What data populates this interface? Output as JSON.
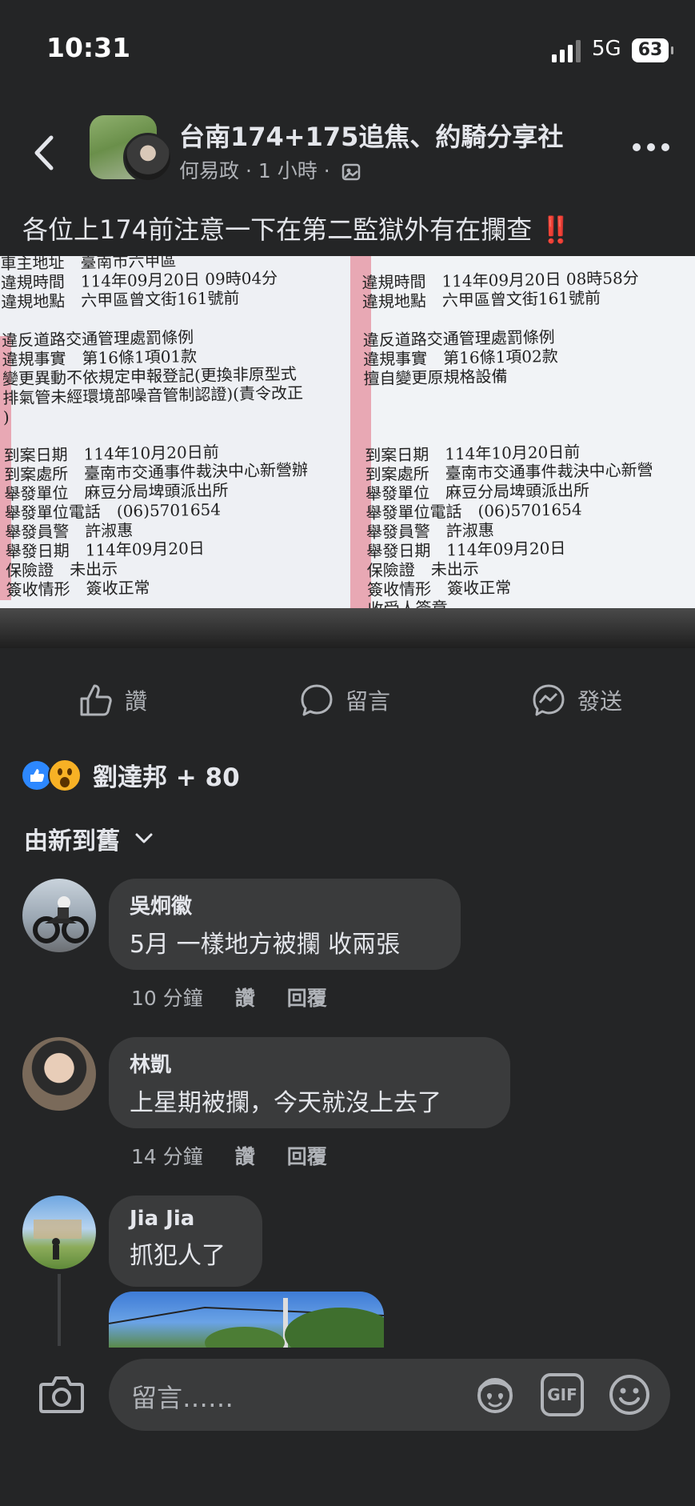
{
  "status_bar": {
    "time": "10:31",
    "network": "5G",
    "battery": "63"
  },
  "header": {
    "group_name": "台南174+175追焦、約騎分享社",
    "author": "何易政",
    "separator": "·",
    "time": "1 小時",
    "icons": {
      "back": "chevron-left-icon",
      "more": "more-horizontal-icon",
      "audience": "photo-icon"
    }
  },
  "post": {
    "text": "各位上174前注意一下在第二監獄外有在攔查",
    "emoji": "‼️",
    "photo": {
      "left": "車主地址　臺南市六甲區\n違規時間　114年09月20日 09時04分\n違規地點　六甲區曾文街161號前\n\n違反道路交通管理處罰條例\n違規事實　第16條1項01款\n變更異動不依規定申報登記(更換非原型式\n排氣管未經環境部噪音管制認證)(責令改正\n)\n\n到案日期　114年10月20日前\n到案處所　臺南市交通事件裁決中心新營辦\n舉發單位　麻豆分局埤頭派出所\n舉發單位電話　(06)5701654\n舉發員警　許淑惠\n舉發日期　114年09月20日\n保險證　未出示\n簽收情形　簽收正常",
      "right": "違規時間　114年09月20日 08時58分\n違規地點　六甲區曾文街161號前\n\n違反道路交通管理處罰條例\n違規事實　第16條1項02款\n擅自變更原規格設備\n\n\n\n到案日期　114年10月20日前\n到案處所　臺南市交通事件裁決中心新營\n舉發單位　麻豆分局埤頭派出所\n舉發單位電話　(06)5701654\n舉發員警　許淑惠\n舉發日期　114年09月20日\n保險證　未出示\n簽收情形　簽收正常\n收受人簽章"
    }
  },
  "actions": {
    "like": "讚",
    "comment": "留言",
    "send": "發送"
  },
  "reactions": {
    "summary": "劉達邦 + 80",
    "types": [
      "like-icon",
      "wow-icon"
    ]
  },
  "sort": {
    "label": "由新到舊"
  },
  "comments": [
    {
      "name": "吳炯徽",
      "text": "5月 一樣地方被攔 收兩張",
      "time": "10 分鐘",
      "like": "讚",
      "reply": "回覆"
    },
    {
      "name": "林凱",
      "text": "上星期被攔，今天就沒上去了",
      "time": "14 分鐘",
      "like": "讚",
      "reply": "回覆"
    },
    {
      "name": "Jia Jia",
      "text": "抓犯人了"
    }
  ],
  "composer": {
    "placeholder": "留言……",
    "gif": "GIF"
  },
  "colors": {
    "background": "#242526",
    "bubble": "#3a3b3c",
    "accent": "#2d88ff",
    "alert": "#f02849"
  }
}
